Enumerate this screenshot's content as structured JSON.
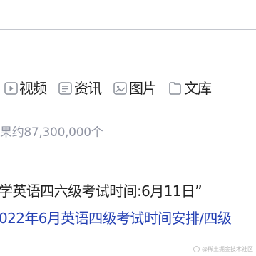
{
  "tabs": [
    {
      "label": "视频",
      "icon": "video-play-icon"
    },
    {
      "label": "资讯",
      "icon": "news-icon"
    },
    {
      "label": "图片",
      "icon": "image-icon"
    },
    {
      "label": "文库",
      "icon": "document-icon"
    }
  ],
  "result_count": "果约87,300,000个",
  "result": {
    "title": "学英语四六级考试时间:6月11日”",
    "link": "022年6月英语四级考试时间安排/四级"
  },
  "watermark": "@稀土掘金技术社区"
}
